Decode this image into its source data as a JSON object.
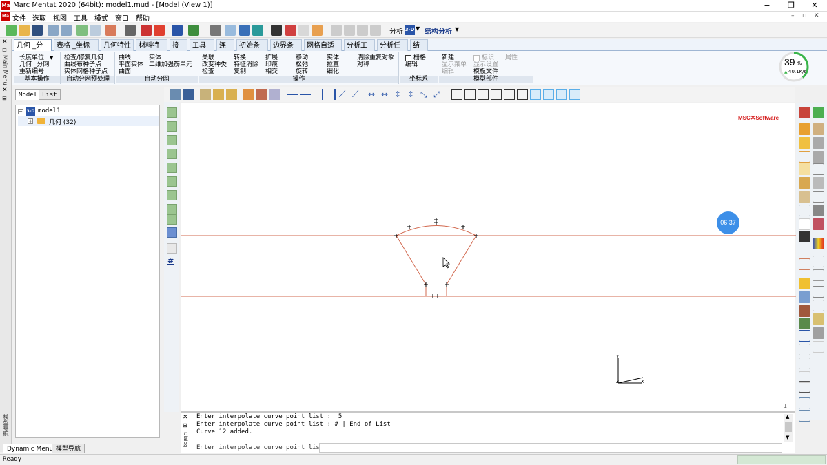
{
  "window": {
    "title": "Marc Mentat 2020 (64bit): model1.mud - [Model (View 1)]",
    "app_icon": "Ma"
  },
  "menu": [
    "文件",
    "选取",
    "视图",
    "工具",
    "模式",
    "窗口",
    "帮助"
  ],
  "toolbar": {
    "analysis_label": "分析",
    "view_mode": "3-D",
    "analysis_type": "结构分析"
  },
  "tabs": [
    "几何 _分网",
    "表格 _坐标系",
    "几何特性",
    "材料特性",
    "接触",
    "工具箱",
    "连接",
    "初始条件",
    "边界条件",
    "网格自适应",
    "分析工况",
    "分析任务",
    "结果"
  ],
  "ribbon": {
    "basic": {
      "items": [
        "长度单位",
        "几何 _分网",
        "重新编号"
      ],
      "label": "基本操作"
    },
    "auto_mesh_pre": {
      "items": [
        "检查/修复几何",
        "曲线布种子点",
        "实体网格种子点"
      ],
      "label": "自动分网预处理"
    },
    "auto_mesh": {
      "items": [
        "曲线",
        "平面实体",
        "曲面",
        "实体",
        "二维加强筋单元"
      ],
      "label": "自动分网"
    },
    "ops": {
      "items": [
        "关联",
        "改变种类",
        "检查",
        "转换",
        "特征消除",
        "复制",
        "扩展",
        "印痕",
        "相交",
        "移动",
        "松弛",
        "旋转",
        "实体",
        "拉直",
        "细化",
        "清除重复对象",
        "对称"
      ],
      "label": "操作"
    },
    "coord": {
      "items": [
        "栅格",
        "编辑"
      ],
      "label": "坐标系"
    },
    "parts": {
      "items": [
        "新建",
        "显示菜单",
        "编辑",
        "标识",
        "显示设置",
        "模板文件",
        "属性"
      ],
      "label": "模型部件"
    }
  },
  "network": {
    "percent": "39",
    "unit": "%",
    "rate": "40.1K/s"
  },
  "side_labels": {
    "main_menu": "Main Menu",
    "model_nav": "模型导航",
    "dialog": "Dialog"
  },
  "panel": {
    "tabs": [
      "Model",
      "List"
    ],
    "tree": [
      {
        "label": "model1",
        "badge": "3-D",
        "expander": "−"
      },
      {
        "label": "几何 (32)",
        "expander": "+"
      }
    ],
    "bottom_tabs": [
      "Dynamic Menu",
      "模型导航"
    ]
  },
  "canvas": {
    "logo_left": "MSC",
    "logo_right": "Software",
    "timer": "06:37",
    "page_number": "1",
    "axis_x": "X",
    "axis_y": "Y",
    "axis_z": "Z"
  },
  "dialog": {
    "lines": [
      "Enter interpolate curve point list :  5",
      "Enter interpolate curve point list : # | End of List",
      "Curve 12 added."
    ],
    "prompt": "Enter interpolate curve point list :"
  },
  "status": {
    "text": "Ready"
  },
  "colors": {
    "curve": "#d2694f",
    "accent_tab": "#4a7ab5",
    "timer_bg": "#3d8fe8",
    "network_ring": "#39b54a",
    "logo_red": "#d62020"
  }
}
